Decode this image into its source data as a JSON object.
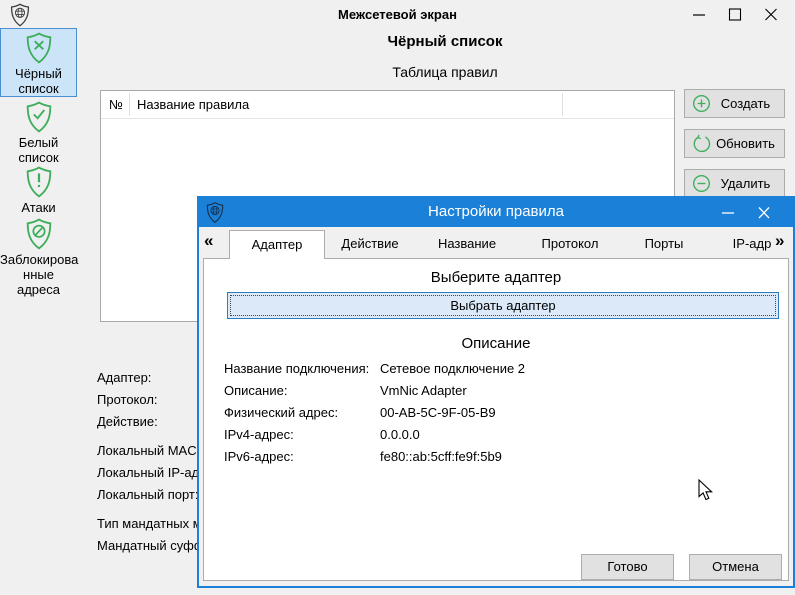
{
  "app": {
    "title": "Межсетевой экран"
  },
  "sidebar": {
    "items": [
      {
        "line1": "Чёрный",
        "line2": "список",
        "icon": "shield-x",
        "selected": true
      },
      {
        "line1": "Белый",
        "line2": "список",
        "icon": "shield-check",
        "selected": false
      },
      {
        "line1": "Атаки",
        "line2": "",
        "icon": "shield-exclamation",
        "selected": false
      },
      {
        "line1": "Заблокирова",
        "line2": "нные адреса",
        "icon": "shield-blocked",
        "selected": false
      }
    ]
  },
  "main": {
    "heading": "Чёрный список",
    "subheading": "Таблица правил",
    "table": {
      "col_number": "№",
      "col_name": "Название правила"
    },
    "actions": {
      "create": "Создать",
      "refresh": "Обновить",
      "delete": "Удалить"
    },
    "background_labels": [
      "Адаптер:",
      "Протокол:",
      "Действие:",
      "Локальный MAC-ад",
      "Локальный IP-адре",
      "Локальный порт:",
      "Тип мандатных ме",
      "Мандатный суффи"
    ]
  },
  "dialog": {
    "title": "Настройки правила",
    "scroll_left": "«",
    "scroll_right": "»",
    "tabs": [
      "Адаптер",
      "Действие",
      "Название",
      "Протокол",
      "Порты",
      "IP-адр"
    ],
    "active_tab": "Адаптер",
    "select_heading": "Выберите адаптер",
    "select_button": "Выбрать адаптер",
    "description_heading": "Описание",
    "fields": [
      {
        "label": "Название подключения:",
        "value": "Сетевое подключение 2"
      },
      {
        "label": "Описание:",
        "value": "VmNic Adapter"
      },
      {
        "label": "Физический адрес:",
        "value": "00-AB-5C-9F-05-B9"
      },
      {
        "label": "IPv4-адрес:",
        "value": "0.0.0.0"
      },
      {
        "label": "IPv6-адрес:",
        "value": "fe80::ab:5cff:fe9f:5b9"
      }
    ],
    "done_button": "Готово",
    "cancel_button": "Отмена"
  },
  "colors": {
    "accent_blue": "#1b81d8",
    "shield_green": "#3fae5c",
    "selected_item_bg": "#cce4f7",
    "selected_item_border": "#4a90d0",
    "button_bg": "#e1e1e1",
    "button_border": "#adadad",
    "select_button_bg": "#dbe9f8",
    "select_button_border": "#2d7dbf"
  }
}
